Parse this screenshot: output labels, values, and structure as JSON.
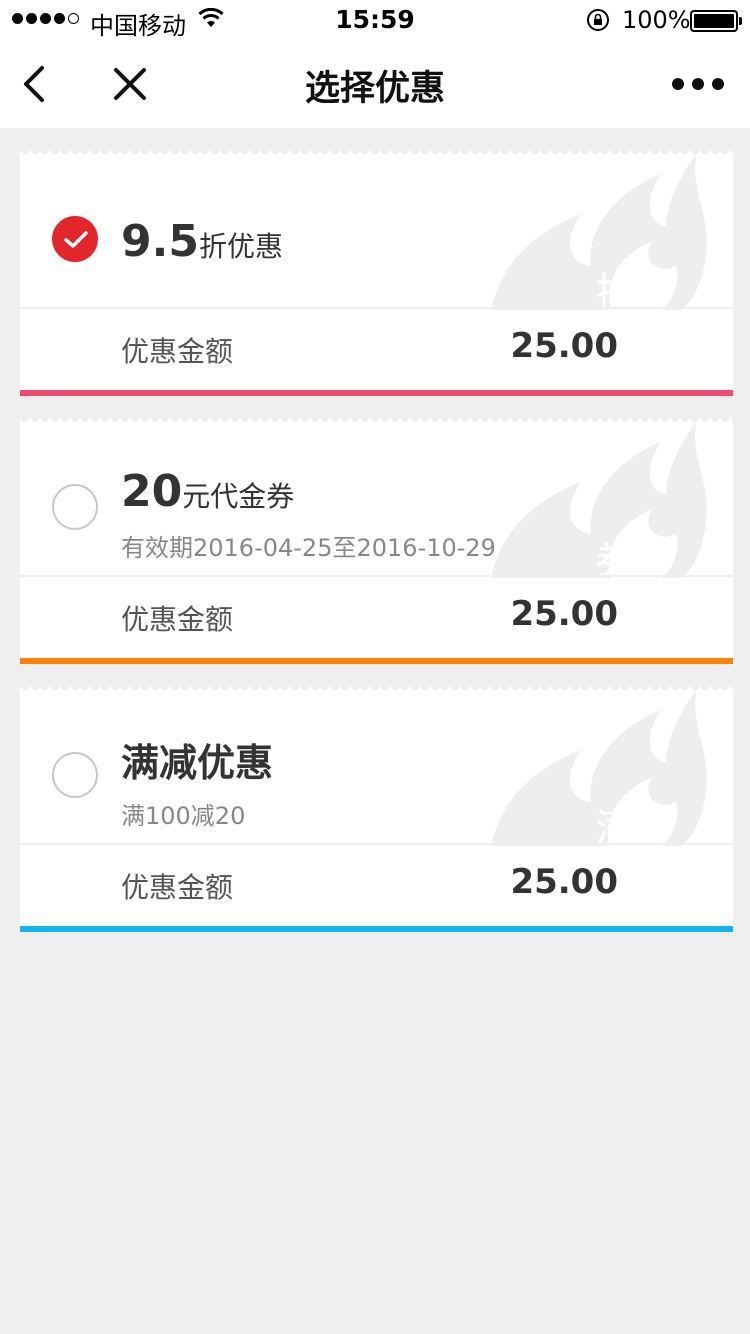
{
  "status_bar": {
    "carrier": "中国移动",
    "time": "15:59",
    "battery": "100%"
  },
  "nav": {
    "title": "选择优惠",
    "icons": [
      "back-arrow-icon",
      "close-icon",
      "more-icon"
    ]
  },
  "coupons": [
    {
      "value": "9.5",
      "unit": "折优惠",
      "subtitle": "",
      "watermark_char": "折",
      "amount_label": "优惠金额",
      "amount": "25.00",
      "accent_color": "#f04a6e",
      "selected": true
    },
    {
      "value": "20",
      "unit": "元代金券",
      "subtitle": "有效期2016-04-25至2016-10-29",
      "watermark_char": "券",
      "amount_label": "优惠金额",
      "amount": "25.00",
      "accent_color": "#ff8208",
      "selected": false
    },
    {
      "value": "满减优惠",
      "unit": "",
      "subtitle": "满100减20",
      "watermark_char": "满",
      "amount_label": "优惠金额",
      "amount": "25.00",
      "accent_color": "#12b5ef",
      "selected": false
    }
  ],
  "colors": {
    "background": "#efefef",
    "selected_radio": "#e3262c",
    "watermark": "#eeeeee"
  }
}
